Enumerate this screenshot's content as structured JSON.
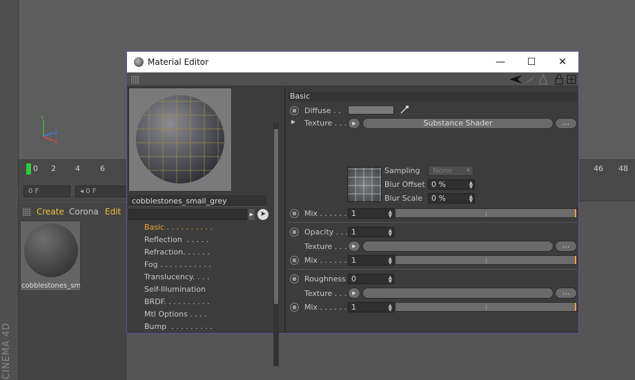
{
  "app": {
    "brand_text": "CINEMA 4D"
  },
  "timeline": {
    "ticks": [
      "0",
      "2",
      "4",
      "6",
      "46",
      "48"
    ],
    "current_frame": "0 F",
    "start_frame": "0 F"
  },
  "material_manager": {
    "menu": [
      "Create",
      "Corona",
      "Edit"
    ],
    "material_name": "cobblestones_sm"
  },
  "window": {
    "title": "Material Editor",
    "minimize": "—",
    "maximize": "☐",
    "close": "✕"
  },
  "editor": {
    "material_name": "cobblestones_small_grey",
    "channels": [
      {
        "label": "Basic . . . . . . . . . .",
        "active": true
      },
      {
        "label": "Reflection  . . . . .",
        "active": false
      },
      {
        "label": "Refraction. . . . . .",
        "active": false
      },
      {
        "label": "Fog . . . . . . . . . . .",
        "active": false
      },
      {
        "label": "Translucency. . . .",
        "active": false
      },
      {
        "label": "Self-Illumination",
        "active": false
      },
      {
        "label": "BRDF. . . . . . . . . .",
        "active": false
      },
      {
        "label": "Mtl Options . . . .",
        "active": false
      },
      {
        "label": "Bump  . . . . . . . . .",
        "active": false
      }
    ],
    "section_title": "Basic",
    "diffuse": {
      "label": "Diffuse . .",
      "texture_label": "Texture . . .",
      "shader_name": "Substance Shader",
      "more_button": "...",
      "sampling_label": "Sampling",
      "sampling_value": "None",
      "blur_offset_label": "Blur Offset",
      "blur_offset_value": "0 %",
      "blur_scale_label": "Blur Scale",
      "blur_scale_value": "0 %",
      "mix_label": "Mix . . . . . .",
      "mix_value": "1"
    },
    "opacity": {
      "label": "Opacity . . .",
      "value": "1",
      "texture_label": "Texture . . .",
      "more_button": "...",
      "mix_label": "Mix . . . . . .",
      "mix_value": "1"
    },
    "roughness": {
      "label": "Roughness",
      "value": "0",
      "texture_label": "Texture . . .",
      "more_button": "...",
      "mix_label": "Mix . . . . . .",
      "mix_value": "1"
    }
  }
}
